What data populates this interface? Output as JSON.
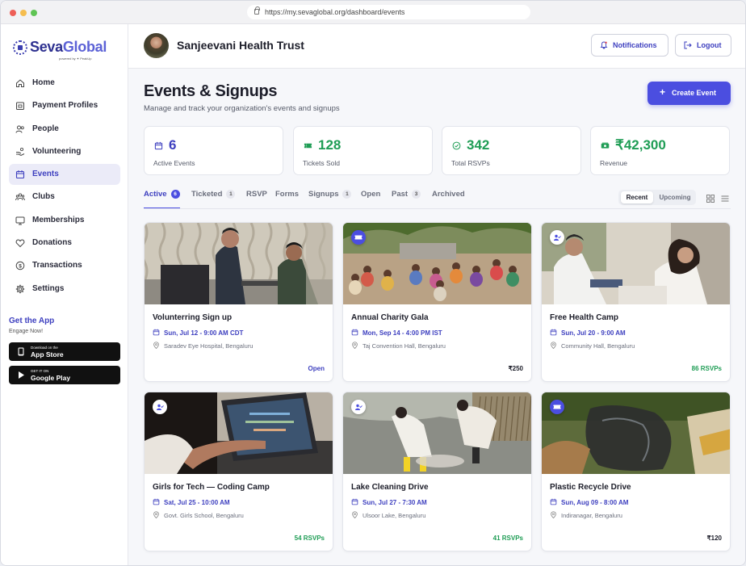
{
  "browser": {
    "url": "https://my.sevaglobal.org/dashboard/events"
  },
  "brand": {
    "name_part1": "Seva",
    "name_part2": "Global",
    "powered_by": "powered by ✦ PeakUp"
  },
  "sidebar": {
    "items": [
      {
        "label": "Home",
        "icon": "home-icon"
      },
      {
        "label": "Payment Profiles",
        "icon": "payment-icon"
      },
      {
        "label": "People",
        "icon": "people-icon"
      },
      {
        "label": "Volunteering",
        "icon": "volunteering-icon"
      },
      {
        "label": "Events",
        "icon": "calendar-icon",
        "active": true
      },
      {
        "label": "Clubs",
        "icon": "clubs-icon"
      },
      {
        "label": "Memberships",
        "icon": "membership-icon"
      },
      {
        "label": "Donations",
        "icon": "heart-icon"
      },
      {
        "label": "Transactions",
        "icon": "dollar-icon"
      },
      {
        "label": "Settings",
        "icon": "gear-icon"
      }
    ],
    "get_app": {
      "title": "Get the App",
      "subtitle": "Engage Now!"
    },
    "app_store": {
      "small": "Download on the",
      "big": "App Store"
    },
    "google_play": {
      "small": "GET IT ON",
      "big": "Google Play"
    }
  },
  "header": {
    "org_name": "Sanjeevani Health Trust",
    "notifications_label": "Notifications",
    "logout_label": "Logout"
  },
  "page": {
    "title": "Events & Signups",
    "subtitle": "Manage and track your organization's events and signups",
    "create_label": "Create Event"
  },
  "stats": [
    {
      "value": "6",
      "label": "Active Events",
      "color": "#3d3fbf",
      "icon": "calendar-icon"
    },
    {
      "value": "128",
      "label": "Tickets Sold",
      "color": "#1f9d55",
      "icon": "ticket-icon"
    },
    {
      "value": "342",
      "label": "Total RSVPs",
      "color": "#1f9d55",
      "icon": "check-circle-icon"
    },
    {
      "value": "₹42,300",
      "label": "Revenue",
      "color": "#1f9d55",
      "icon": "cash-icon"
    }
  ],
  "tabs": [
    {
      "label": "Active",
      "count": "6",
      "active": true
    },
    {
      "label": "Ticketed",
      "count": "1"
    },
    {
      "label": "RSVP",
      "count": ""
    },
    {
      "label": "Forms",
      "count": ""
    },
    {
      "label": "Signups",
      "count": "1"
    },
    {
      "label": "Open",
      "count": ""
    },
    {
      "label": "Past",
      "count": "3"
    },
    {
      "label": "Archived",
      "count": ""
    }
  ],
  "sort_toggle": {
    "options": [
      "Recent",
      "Upcoming"
    ],
    "selected": "Recent"
  },
  "events": [
    {
      "title": "Volunterring Sign up",
      "date": "Sun, Jul 12 - 9:00 AM CDT",
      "location": "Saradev Eye Hospital, Bengaluru",
      "footer": "Open",
      "footer_color": "#3d3fbf",
      "badge": "",
      "scene": "office"
    },
    {
      "title": "Annual Charity Gala",
      "date": "Mon, Sep 14 - 4:00 PM IST",
      "location": "Taj Convention Hall, Bengaluru",
      "footer": "₹250",
      "footer_color": "#1d1e2a",
      "badge": "ticket-icon",
      "scene": "outdoor"
    },
    {
      "title": "Free Health Camp",
      "date": "Sun, Jul 20 - 9:00 AM",
      "location": "Community Hall, Bengaluru",
      "footer": "86 RSVPs",
      "footer_color": "#1f9d55",
      "badge": "rsvp-icon",
      "scene": "clinic"
    },
    {
      "title": "Girls for Tech — Coding Camp",
      "date": "Sat, Jul 25 - 10:00 AM",
      "location": "Govt. Girls School, Bengaluru",
      "footer": "54 RSVPs",
      "footer_color": "#1f9d55",
      "badge": "rsvp-icon",
      "scene": "laptop"
    },
    {
      "title": "Lake Cleaning Drive",
      "date": "Sun, Jul 27 - 7:30 AM",
      "location": "Ulsoor Lake, Bengaluru",
      "footer": "41 RSVPs",
      "footer_color": "#1f9d55",
      "badge": "rsvp-icon",
      "scene": "lake"
    },
    {
      "title": "Plastic Recycle Drive",
      "date": "Sun, Aug 09 - 8:00 AM",
      "location": "Indiranagar, Bengaluru",
      "footer": "₹120",
      "footer_color": "#1d1e2a",
      "badge": "ticket-icon",
      "scene": "recycle"
    }
  ]
}
